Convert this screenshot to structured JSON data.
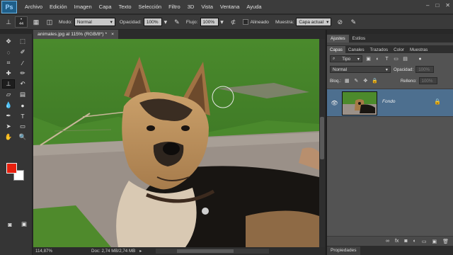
{
  "app": {
    "logo": "Ps"
  },
  "menu": [
    "Archivo",
    "Edición",
    "Imagen",
    "Capa",
    "Texto",
    "Selección",
    "Filtro",
    "3D",
    "Vista",
    "Ventana",
    "Ayuda"
  ],
  "window_controls": {
    "minimize": "–",
    "maximize": "□",
    "close": "✕"
  },
  "options": {
    "brush_size": "44",
    "mode_label": "Modo:",
    "mode_value": "Normal",
    "opacity_label": "Opacidad:",
    "opacity_value": "100%",
    "flow_label": "Flujo:",
    "flow_value": "100%",
    "aligned_label": "Alineado",
    "sample_label": "Muestra:",
    "sample_value": "Capa actual"
  },
  "document": {
    "tab_title": "animales.jpg al 115% (RGB/8*) *",
    "close": "×"
  },
  "status": {
    "zoom": "114,87%",
    "doc": "Doc: 2,74 MB/2,74 MB",
    "arrow": "▸"
  },
  "panels_top": {
    "tabs": [
      "Ajustes",
      "Estilos"
    ]
  },
  "layers": {
    "tabs": [
      "Capas",
      "Canales",
      "Trazados",
      "Color",
      "Muestras"
    ],
    "kind_value": "Tipo",
    "blend_value": "Normal",
    "opacity_label": "Opacidad:",
    "opacity_value": "100%",
    "lock_label": "Bloq.:",
    "fill_label": "Relleno:",
    "fill_value": "100%",
    "layer_name": "Fondo"
  },
  "properties": {
    "tab": "Propiedades"
  },
  "colors": {
    "foreground": "#e8200e",
    "background": "#ffffff",
    "selected_layer": "#4d6f8f"
  }
}
